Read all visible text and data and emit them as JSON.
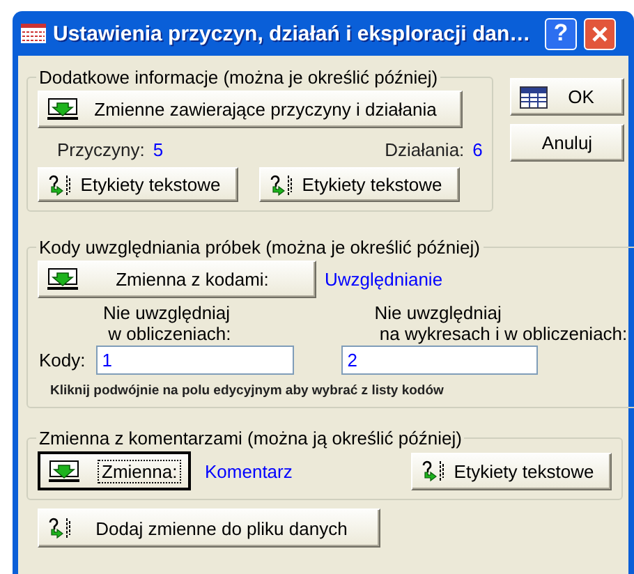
{
  "window": {
    "title": "Ustawienia przyczyn, działań i eksploracji dan…",
    "help_button": "?"
  },
  "additional_info": {
    "legend": "Dodatkowe informacje (można je określić później)",
    "variables_button": {
      "label": "Zmienne zawierające przyczyny i działania",
      "focused": false
    },
    "causes_label": "Przyczyny:",
    "causes_value": "5",
    "actions_label": "Działania:",
    "actions_value": "6",
    "label_buttons": [
      {
        "label": "Etykiety tekstowe",
        "focused": false
      },
      {
        "label": "Etykiety tekstowe",
        "focused": false
      }
    ]
  },
  "inclusion_codes": {
    "legend": "Kody uwzględniania próbek (można je określić później)",
    "variable_button": {
      "label": "Zmienna z kodami:",
      "focused": false
    },
    "variable_value": "Uwzględnianie",
    "exclude_calc_label": "Nie uwzględniaj\n w obliczeniach:",
    "exclude_all_label": "Nie uwzględniaj\n na wykresach i w obliczeniach:",
    "codes_label": "Kody:",
    "exclude_calc_value": "1",
    "exclude_all_value": "2",
    "hint": "Kliknij podwójnie na polu edycyjnym aby wybrać z listy kodów"
  },
  "comments": {
    "legend": "Zmienna z komentarzami (można ją określić później)",
    "variable_button": {
      "label": "Zmienna:",
      "focused": true
    },
    "variable_value": "Komentarz",
    "labels_button": {
      "label": "Etykiety tekstowe",
      "focused": false
    }
  },
  "add_button": {
    "label": "Dodaj zmienne do pliku danych",
    "focused": false
  },
  "ok_button": {
    "label": "OK",
    "focused": false
  },
  "cancel_button": {
    "label": "Anuluj",
    "focused": false
  }
}
